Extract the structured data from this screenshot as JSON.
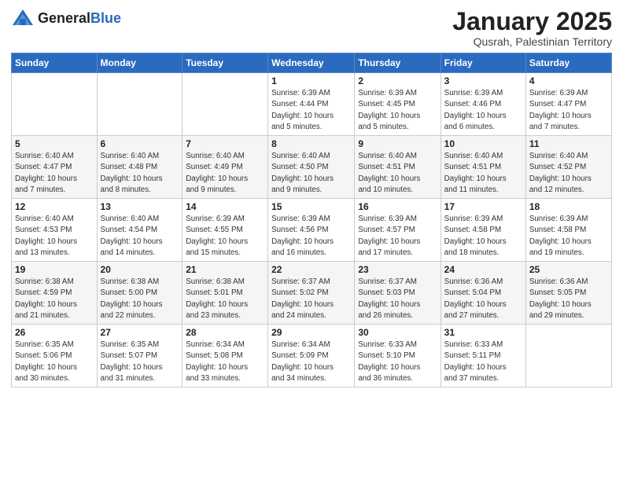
{
  "header": {
    "logo_general": "General",
    "logo_blue": "Blue",
    "title": "January 2025",
    "subtitle": "Qusrah, Palestinian Territory"
  },
  "columns": [
    "Sunday",
    "Monday",
    "Tuesday",
    "Wednesday",
    "Thursday",
    "Friday",
    "Saturday"
  ],
  "weeks": [
    [
      {
        "num": "",
        "info": ""
      },
      {
        "num": "",
        "info": ""
      },
      {
        "num": "",
        "info": ""
      },
      {
        "num": "1",
        "info": "Sunrise: 6:39 AM\nSunset: 4:44 PM\nDaylight: 10 hours\nand 5 minutes."
      },
      {
        "num": "2",
        "info": "Sunrise: 6:39 AM\nSunset: 4:45 PM\nDaylight: 10 hours\nand 5 minutes."
      },
      {
        "num": "3",
        "info": "Sunrise: 6:39 AM\nSunset: 4:46 PM\nDaylight: 10 hours\nand 6 minutes."
      },
      {
        "num": "4",
        "info": "Sunrise: 6:39 AM\nSunset: 4:47 PM\nDaylight: 10 hours\nand 7 minutes."
      }
    ],
    [
      {
        "num": "5",
        "info": "Sunrise: 6:40 AM\nSunset: 4:47 PM\nDaylight: 10 hours\nand 7 minutes."
      },
      {
        "num": "6",
        "info": "Sunrise: 6:40 AM\nSunset: 4:48 PM\nDaylight: 10 hours\nand 8 minutes."
      },
      {
        "num": "7",
        "info": "Sunrise: 6:40 AM\nSunset: 4:49 PM\nDaylight: 10 hours\nand 9 minutes."
      },
      {
        "num": "8",
        "info": "Sunrise: 6:40 AM\nSunset: 4:50 PM\nDaylight: 10 hours\nand 9 minutes."
      },
      {
        "num": "9",
        "info": "Sunrise: 6:40 AM\nSunset: 4:51 PM\nDaylight: 10 hours\nand 10 minutes."
      },
      {
        "num": "10",
        "info": "Sunrise: 6:40 AM\nSunset: 4:51 PM\nDaylight: 10 hours\nand 11 minutes."
      },
      {
        "num": "11",
        "info": "Sunrise: 6:40 AM\nSunset: 4:52 PM\nDaylight: 10 hours\nand 12 minutes."
      }
    ],
    [
      {
        "num": "12",
        "info": "Sunrise: 6:40 AM\nSunset: 4:53 PM\nDaylight: 10 hours\nand 13 minutes."
      },
      {
        "num": "13",
        "info": "Sunrise: 6:40 AM\nSunset: 4:54 PM\nDaylight: 10 hours\nand 14 minutes."
      },
      {
        "num": "14",
        "info": "Sunrise: 6:39 AM\nSunset: 4:55 PM\nDaylight: 10 hours\nand 15 minutes."
      },
      {
        "num": "15",
        "info": "Sunrise: 6:39 AM\nSunset: 4:56 PM\nDaylight: 10 hours\nand 16 minutes."
      },
      {
        "num": "16",
        "info": "Sunrise: 6:39 AM\nSunset: 4:57 PM\nDaylight: 10 hours\nand 17 minutes."
      },
      {
        "num": "17",
        "info": "Sunrise: 6:39 AM\nSunset: 4:58 PM\nDaylight: 10 hours\nand 18 minutes."
      },
      {
        "num": "18",
        "info": "Sunrise: 6:39 AM\nSunset: 4:58 PM\nDaylight: 10 hours\nand 19 minutes."
      }
    ],
    [
      {
        "num": "19",
        "info": "Sunrise: 6:38 AM\nSunset: 4:59 PM\nDaylight: 10 hours\nand 21 minutes."
      },
      {
        "num": "20",
        "info": "Sunrise: 6:38 AM\nSunset: 5:00 PM\nDaylight: 10 hours\nand 22 minutes."
      },
      {
        "num": "21",
        "info": "Sunrise: 6:38 AM\nSunset: 5:01 PM\nDaylight: 10 hours\nand 23 minutes."
      },
      {
        "num": "22",
        "info": "Sunrise: 6:37 AM\nSunset: 5:02 PM\nDaylight: 10 hours\nand 24 minutes."
      },
      {
        "num": "23",
        "info": "Sunrise: 6:37 AM\nSunset: 5:03 PM\nDaylight: 10 hours\nand 26 minutes."
      },
      {
        "num": "24",
        "info": "Sunrise: 6:36 AM\nSunset: 5:04 PM\nDaylight: 10 hours\nand 27 minutes."
      },
      {
        "num": "25",
        "info": "Sunrise: 6:36 AM\nSunset: 5:05 PM\nDaylight: 10 hours\nand 29 minutes."
      }
    ],
    [
      {
        "num": "26",
        "info": "Sunrise: 6:35 AM\nSunset: 5:06 PM\nDaylight: 10 hours\nand 30 minutes."
      },
      {
        "num": "27",
        "info": "Sunrise: 6:35 AM\nSunset: 5:07 PM\nDaylight: 10 hours\nand 31 minutes."
      },
      {
        "num": "28",
        "info": "Sunrise: 6:34 AM\nSunset: 5:08 PM\nDaylight: 10 hours\nand 33 minutes."
      },
      {
        "num": "29",
        "info": "Sunrise: 6:34 AM\nSunset: 5:09 PM\nDaylight: 10 hours\nand 34 minutes."
      },
      {
        "num": "30",
        "info": "Sunrise: 6:33 AM\nSunset: 5:10 PM\nDaylight: 10 hours\nand 36 minutes."
      },
      {
        "num": "31",
        "info": "Sunrise: 6:33 AM\nSunset: 5:11 PM\nDaylight: 10 hours\nand 37 minutes."
      },
      {
        "num": "",
        "info": ""
      }
    ]
  ]
}
